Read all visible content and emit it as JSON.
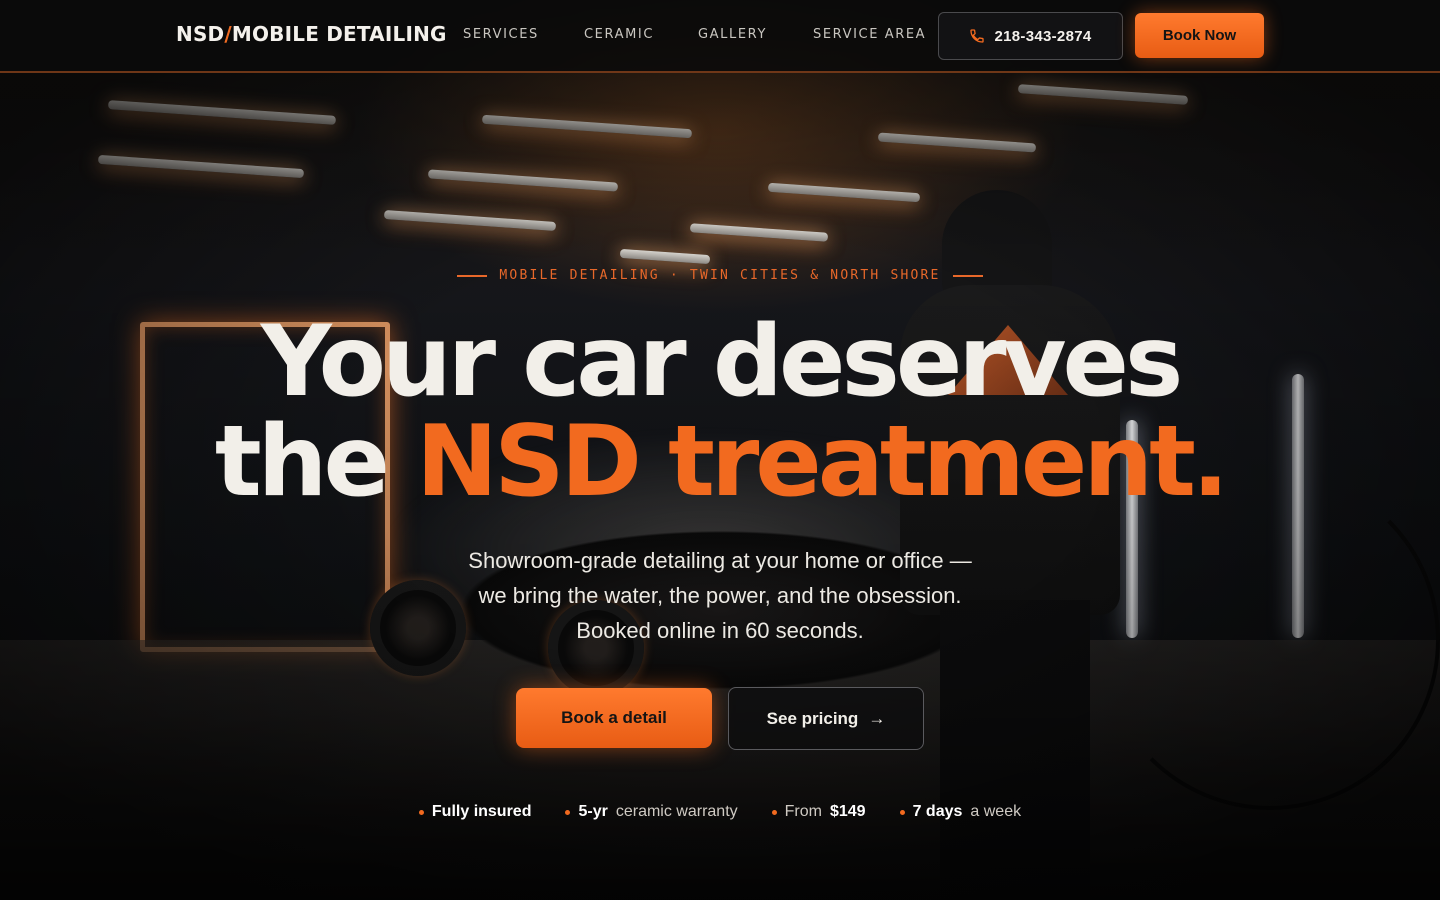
{
  "header": {
    "brand_prefix": "NSD",
    "brand_slash": "/",
    "brand_suffix": "MOBILE DETAILING",
    "nav": [
      "SERVICES",
      "CERAMIC",
      "GALLERY",
      "SERVICE AREA"
    ],
    "phone": "218-343-2874",
    "phone_icon": "phone-icon",
    "book_now": "Book Now"
  },
  "hero": {
    "eyebrow": "MOBILE DETAILING · TWIN CITIES & NORTH SHORE",
    "headline_line1": "Your car deserves",
    "headline_the": "the",
    "headline_accent": "NSD treatment.",
    "subcopy_line1": "Showroom-grade detailing at your home or office —",
    "subcopy_line2": "we bring the water, the power, and the obsession.",
    "subcopy_line3": "Booked online in 60 seconds.",
    "cta_primary": "Book a detail",
    "cta_secondary": "See pricing",
    "cta_secondary_arrow": "→"
  },
  "trust": [
    {
      "bold": "Fully insured",
      "text": ""
    },
    {
      "bold": "5-yr",
      "text": "ceramic warranty"
    },
    {
      "prefix": "From",
      "bold": "$149",
      "text": ""
    },
    {
      "bold": "7 days",
      "text": "a week"
    }
  ],
  "colors": {
    "accent": "#f26a1f",
    "background": "#0d0d0f",
    "text": "#f2efe9"
  }
}
